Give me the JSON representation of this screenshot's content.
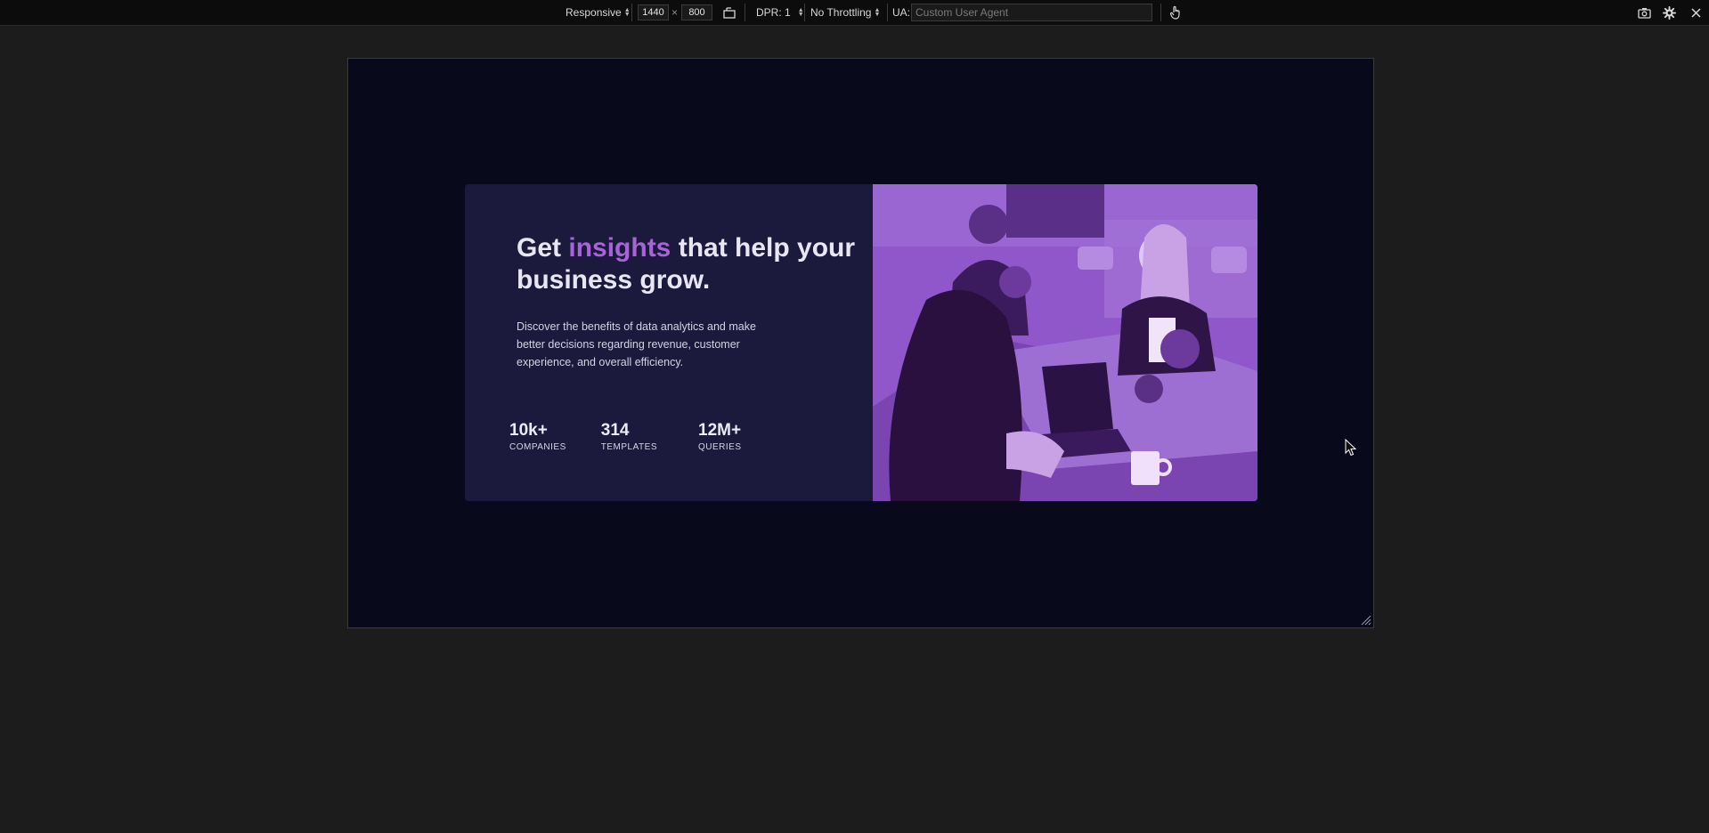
{
  "toolbar": {
    "device_mode": "Responsive",
    "width": "1440",
    "times": "×",
    "height": "800",
    "dpr": "DPR: 1",
    "throttling": "No Throttling",
    "ua_label": "UA:",
    "ua_placeholder": "Custom User Agent"
  },
  "page": {
    "headline_part1": "Get ",
    "headline_accent": "insights",
    "headline_part2": " that help your business grow.",
    "description": "Discover the benefits of data analytics and make better decisions regarding revenue, customer experience, and overall efficiency.",
    "stats": [
      {
        "value": "10k+",
        "label": "COMPANIES"
      },
      {
        "value": "314",
        "label": "TEMPLATES"
      },
      {
        "value": "12M+",
        "label": "QUERIES"
      }
    ],
    "image": {
      "subject": "three women working at a table with a laptop, purple tint"
    }
  },
  "colors": {
    "toolbar_bg": "#0c0c0d",
    "canvas_bg": "#1c1c1c",
    "page_bg": "#080a1b",
    "card_bg": "#1c1a3c",
    "accent": "#a963d8",
    "image_tint": "#8a52c4"
  },
  "icons": [
    "rotate-icon",
    "touch-icon",
    "screenshot-icon",
    "settings-icon",
    "close-icon",
    "resize-handle-icon",
    "mouse-cursor-icon"
  ]
}
